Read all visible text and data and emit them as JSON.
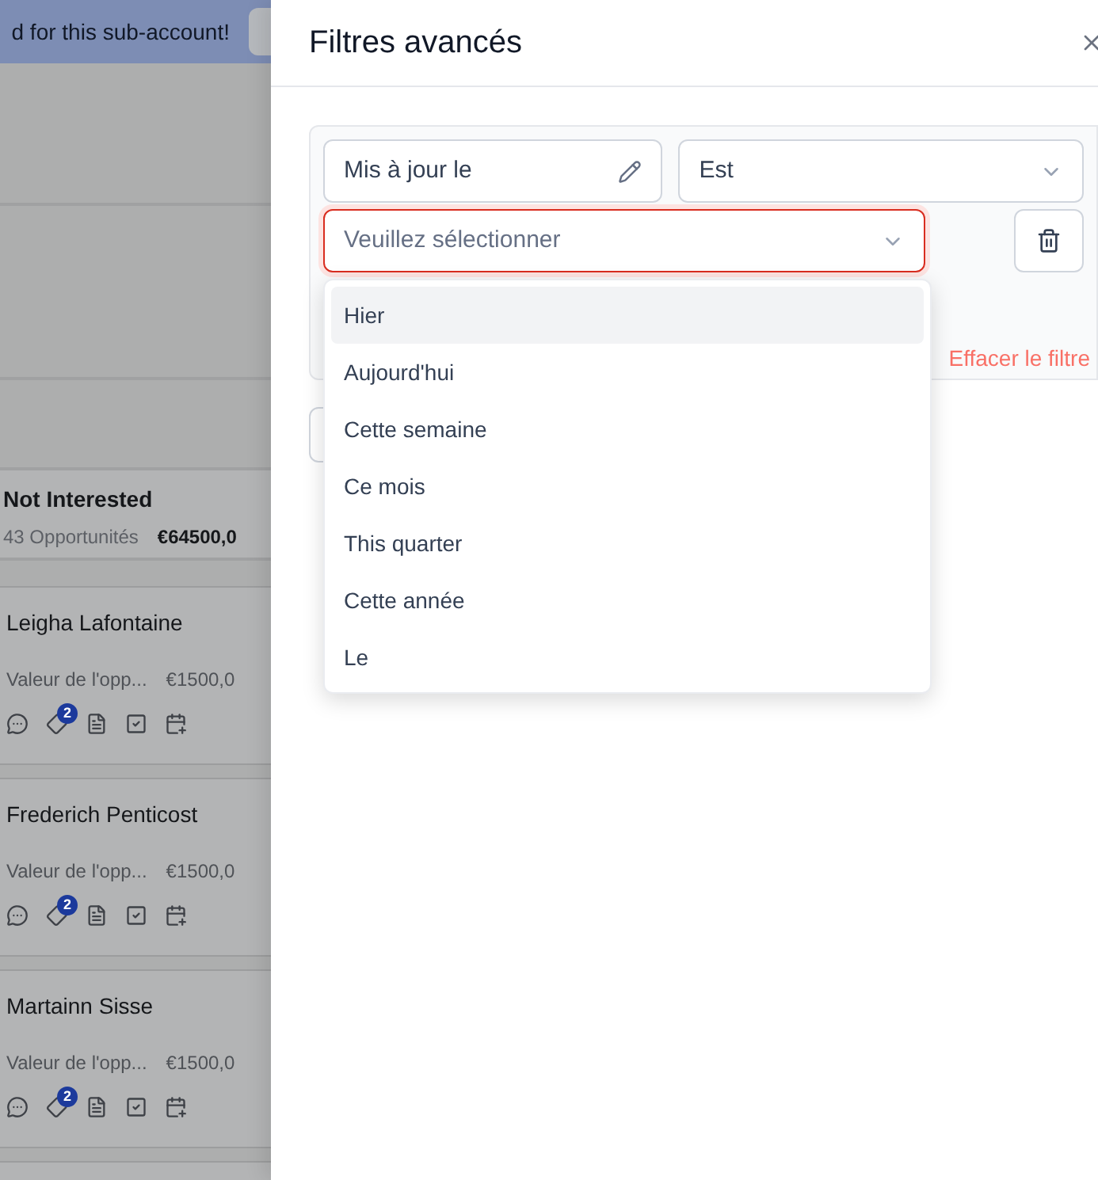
{
  "banner": {
    "text": "d for this sub-account!"
  },
  "board": {
    "column": {
      "title": "Not Interested",
      "count": "43 Opportunités",
      "amount": "€64500,0"
    },
    "cards": [
      {
        "name": "Leigha Lafontaine",
        "value_label": "Valeur de l'opp...",
        "value": "€1500,0",
        "badge": "2"
      },
      {
        "name": "Frederich Penticost",
        "value_label": "Valeur de l'opp...",
        "value": "€1500,0",
        "badge": "2"
      },
      {
        "name": "Martainn Sisse",
        "value_label": "Valeur de l'opp...",
        "value": "€1500,0",
        "badge": "2"
      }
    ]
  },
  "panel": {
    "title": "Filtres avancés",
    "filter": {
      "field": "Mis à jour le",
      "operator": "Est",
      "value_placeholder": "Veuillez sélectionner",
      "invalid": true,
      "clear": "Effacer le filtre"
    },
    "dropdown": [
      {
        "label": "Hier",
        "selected": true
      },
      {
        "label": "Aujourd'hui",
        "selected": false
      },
      {
        "label": "Cette semaine",
        "selected": false
      },
      {
        "label": "Ce mois",
        "selected": false
      },
      {
        "label": "This quarter",
        "selected": false
      },
      {
        "label": "Cette année",
        "selected": false
      },
      {
        "label": "Le",
        "selected": false
      }
    ]
  }
}
